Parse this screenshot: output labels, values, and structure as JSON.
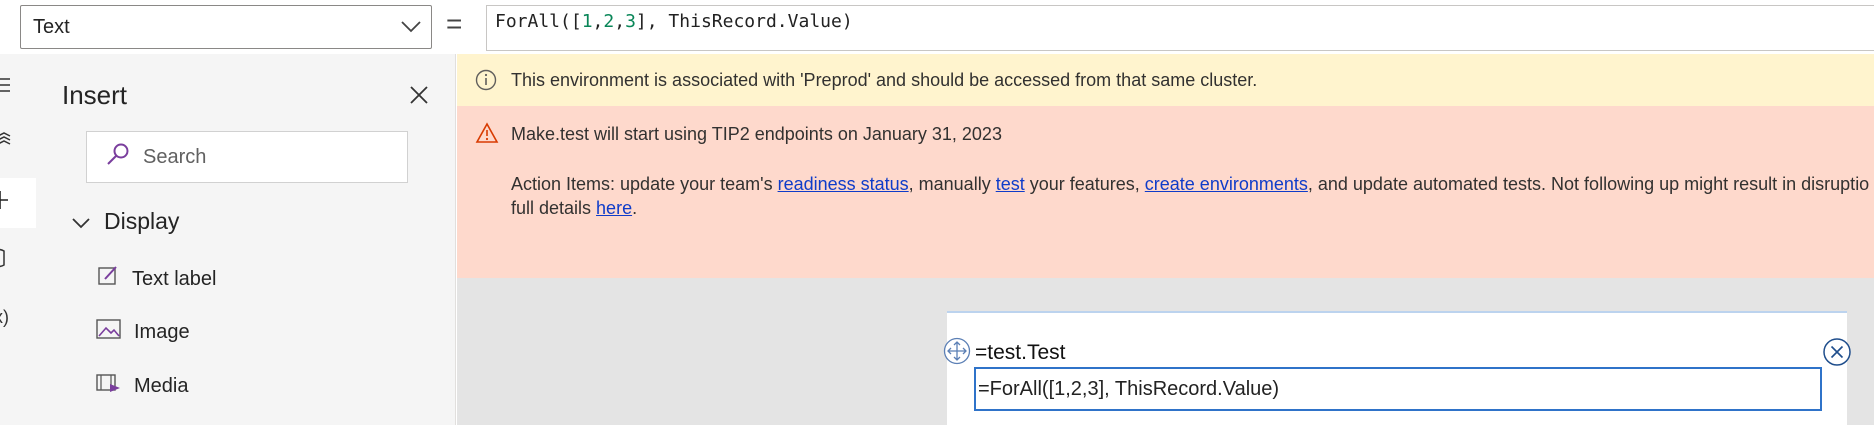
{
  "formula_bar": {
    "property": "Text",
    "equals": "=",
    "formula_prefix": "ForAll([",
    "formula_n1": "1",
    "formula_c1": ",",
    "formula_n2": "2",
    "formula_c2": ",",
    "formula_n3": "3",
    "formula_suffix": "], ThisRecord.Value)"
  },
  "left_rail": {
    "items": [
      {
        "icon": "hamburger-icon",
        "glyph": "≡"
      },
      {
        "icon": "layers-icon",
        "glyph": "≋"
      },
      {
        "icon": "plus-icon",
        "glyph": "+"
      },
      {
        "icon": "data-icon",
        "glyph": "⌷"
      },
      {
        "icon": "variables-icon",
        "glyph": "x)"
      }
    ],
    "active_index": 2
  },
  "insert_pane": {
    "title": "Insert",
    "search_placeholder": "Search",
    "category": "Display",
    "controls": [
      {
        "label": "Text label",
        "icon": "text-label-icon"
      },
      {
        "label": "Image",
        "icon": "image-icon"
      },
      {
        "label": "Media",
        "icon": "media-icon"
      }
    ]
  },
  "banners": {
    "info_text": "This environment is associated with 'Preprod' and should be accessed from that same cluster.",
    "warn_title": "Make.test will start using TIP2 endpoints on January 31, 2023",
    "warn_line1_a": "Action Items: update your team's ",
    "warn_link1": "readiness status",
    "warn_line1_b": ", manually ",
    "warn_link2": "test",
    "warn_line1_c": " your features, ",
    "warn_link3": "create environments",
    "warn_line1_d": ", and update automated tests. Not following up might result in disruptio",
    "warn_line2_a": "full details ",
    "warn_link4": "here",
    "warn_line2_b": "."
  },
  "canvas": {
    "label_text": "=test.Test",
    "formula_edit": "=ForAll([1,2,3], ThisRecord.Value)"
  },
  "colors": {
    "info_bg": "#fff4ce",
    "warn_bg": "#fed9cc",
    "link": "#0f3cc9",
    "selection": "#2f73c9",
    "accent_purple": "#7a3e9d"
  }
}
